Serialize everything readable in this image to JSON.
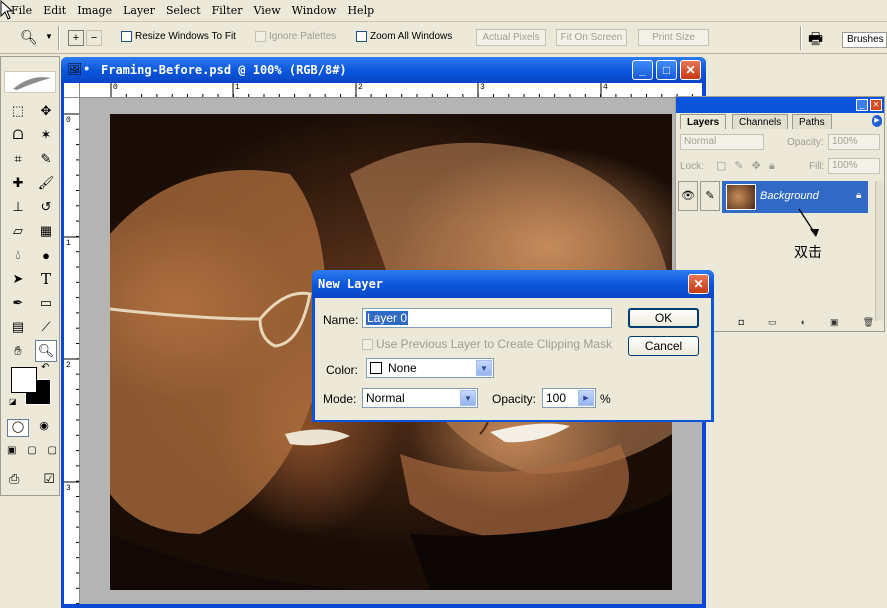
{
  "menu": [
    "File",
    "Edit",
    "Image",
    "Layer",
    "Select",
    "Filter",
    "View",
    "Window",
    "Help"
  ],
  "options": {
    "resize_windows": "Resize Windows To Fit",
    "ignore_palettes": "Ignore Palettes",
    "zoom_all": "Zoom All Windows",
    "actual_pixels": "Actual Pixels",
    "fit_on_screen": "Fit On Screen",
    "print_size": "Print Size",
    "brushes": "Brushes"
  },
  "document": {
    "title": "Framing-Before.psd @ 100% (RGB/8#)",
    "ruler_h": [
      "0",
      "1",
      "2",
      "3",
      "4"
    ],
    "ruler_v": [
      "0",
      "1",
      "2",
      "3"
    ]
  },
  "layers_panel": {
    "tabs": [
      "Layers",
      "Channels",
      "Paths"
    ],
    "blend": "Normal",
    "opacity_label": "Opacity:",
    "opacity": "100%",
    "lock_label": "Lock:",
    "fill_label": "Fill:",
    "fill": "100%",
    "layer_name": "Background",
    "annotation": "双击"
  },
  "dialog": {
    "title": "New Layer",
    "name_label": "Name:",
    "name_value": "Layer 0",
    "clip_label": "Use Previous Layer to Create Clipping Mask",
    "color_label": "Color:",
    "color_value": "None",
    "mode_label": "Mode:",
    "mode_value": "Normal",
    "opacity_label": "Opacity:",
    "opacity_value": "100",
    "percent": "%",
    "ok": "OK",
    "cancel": "Cancel"
  }
}
